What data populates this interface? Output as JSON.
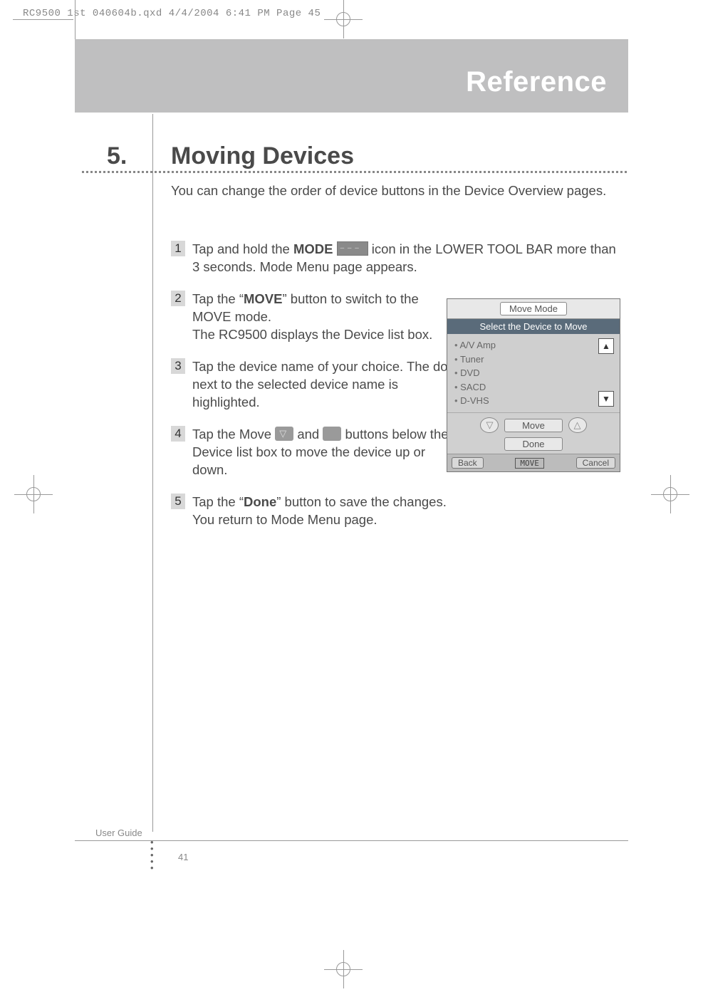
{
  "slug": "RC9500 1st 040604b.qxd  4/4/2004  6:41 PM  Page 45",
  "header": "Reference",
  "section": {
    "num": "5.",
    "title": "Moving Devices"
  },
  "intro": "You can change the order of device buttons in the Device Overview pages.",
  "steps": {
    "s1a": "Tap and hold the ",
    "s1b": "MODE",
    "s1c": " icon in the LOWER TOOL BAR more than 3 seconds. Mode Menu page appears.",
    "s2a": "Tap the “",
    "s2b": "MOVE",
    "s2c": "” button to switch to the MOVE mode.",
    "s2d": "The RC9500 displays the Device list box.",
    "s3a": "Tap the device name of your choice. The dot next to the selected device name is highlighted.",
    "s4a": "Tap the Move ",
    "s4b": " and ",
    "s4c": " buttons below the Device list box to move the device up or down.",
    "s5a": "Tap the “",
    "s5b": "Done",
    "s5c": "” button to save the changes.",
    "s5d": "You return to Mode Menu page."
  },
  "device": {
    "title": "Move Mode",
    "subtitle": "Select the Device to Move",
    "items": [
      "A/V Amp",
      "Tuner",
      "DVD",
      "SACD",
      "D-VHS"
    ],
    "move": "Move",
    "done": "Done",
    "back": "Back",
    "mode": "MOVE",
    "cancel": "Cancel"
  },
  "footer": {
    "guide": "User Guide",
    "page": "41"
  }
}
